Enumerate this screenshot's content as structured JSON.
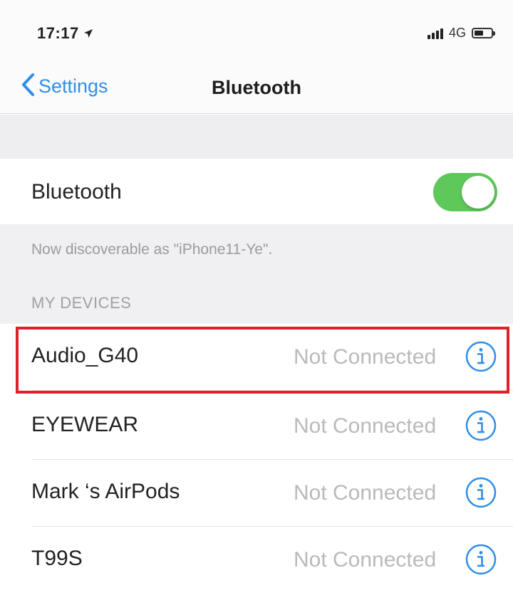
{
  "status_bar": {
    "time": "17:17",
    "network": "4G",
    "icons": [
      "location-arrow-icon",
      "signal-icon",
      "battery-icon"
    ]
  },
  "nav": {
    "back_label": "Settings",
    "title": "Bluetooth",
    "back_icon": "chevron-left-icon"
  },
  "bluetooth": {
    "label": "Bluetooth",
    "enabled": true,
    "discoverable_text": "Now discoverable as \"iPhone11-Ye\"."
  },
  "devices": {
    "section_title": "MY DEVICES",
    "items": [
      {
        "name": "Audio_G40",
        "status": "Not Connected",
        "highlighted": true
      },
      {
        "name": "EYEWEAR",
        "status": "Not Connected"
      },
      {
        "name": "Mark ‘s AirPods",
        "status": "Not Connected"
      },
      {
        "name": "T99S",
        "status": "Not Connected"
      }
    ]
  },
  "colors": {
    "accent": "#2f8ee8",
    "toggle_on": "#5ec85a",
    "highlight": "#e0202a",
    "muted_text": "#b9b9be"
  }
}
